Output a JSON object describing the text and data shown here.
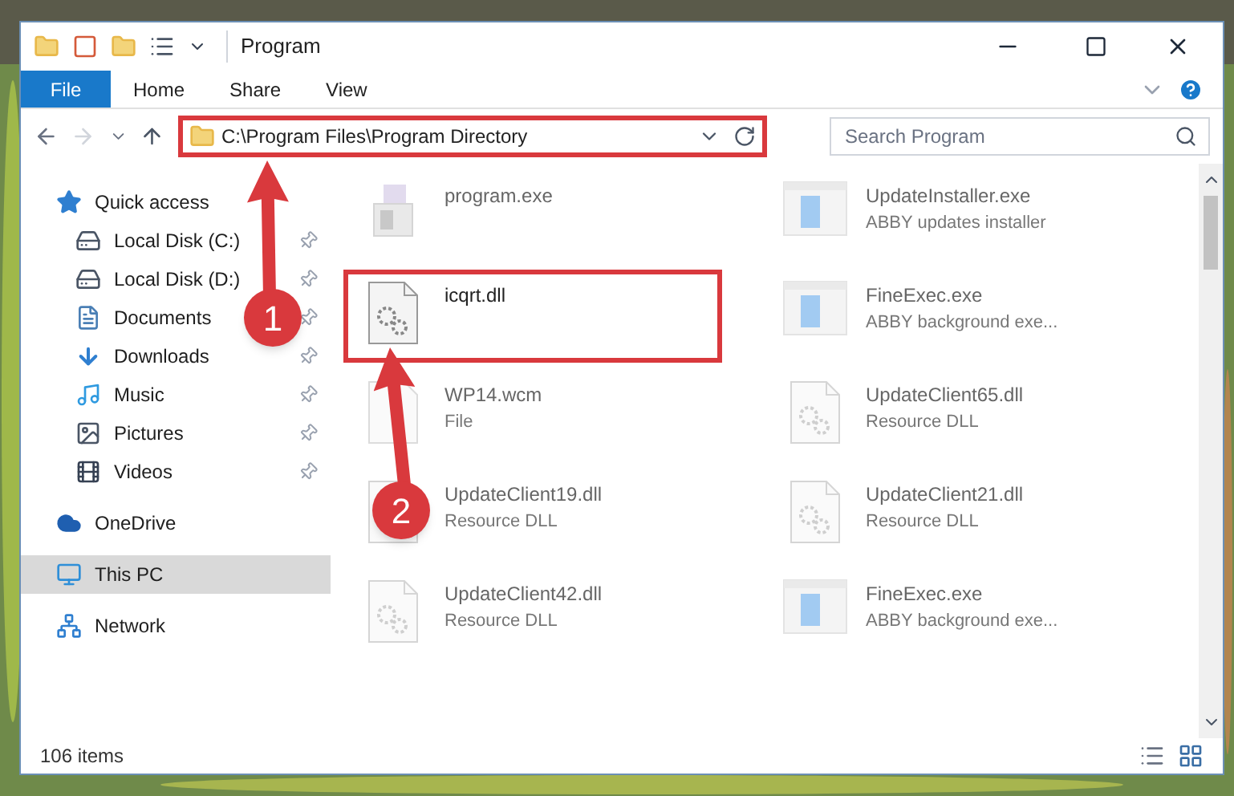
{
  "window": {
    "title": "Program"
  },
  "ribbon": {
    "tabs": [
      {
        "label": "File",
        "kind": "file"
      },
      {
        "label": "Home",
        "kind": "tab"
      },
      {
        "label": "Share",
        "kind": "tab"
      },
      {
        "label": "View",
        "kind": "tab"
      }
    ]
  },
  "address": {
    "path": "C:\\Program Files\\Program Directory",
    "highlighted": true
  },
  "search": {
    "placeholder": "Search Program"
  },
  "sidebar": {
    "items": [
      {
        "label": "Quick access",
        "kind": "star",
        "selected": false,
        "children": [
          {
            "label": "Local Disk (C:)",
            "kind": "drive",
            "pinned": true,
            "selected": false
          },
          {
            "label": "Local Disk (D:)",
            "kind": "drive",
            "pinned": true,
            "selected": false
          },
          {
            "label": "Documents",
            "kind": "documents",
            "pinned": true,
            "selected": false
          },
          {
            "label": "Downloads",
            "kind": "downloads",
            "pinned": true,
            "selected": false
          },
          {
            "label": "Music",
            "kind": "music",
            "pinned": true,
            "selected": false
          },
          {
            "label": "Pictures",
            "kind": "pictures",
            "pinned": true,
            "selected": false
          },
          {
            "label": "Videos",
            "kind": "videos",
            "pinned": true,
            "selected": false
          }
        ]
      },
      {
        "label": "OneDrive",
        "kind": "cloud",
        "selected": false
      },
      {
        "label": "This PC",
        "kind": "pc",
        "selected": true
      },
      {
        "label": "Network",
        "kind": "network",
        "selected": false
      }
    ]
  },
  "files": [
    {
      "name": "program.exe",
      "kind": "installer",
      "faded": true,
      "highlighted": false
    },
    {
      "name": "UpdateInstaller.exe",
      "description": "ABBY updates installer",
      "kind": "app",
      "faded": true,
      "highlighted": false
    },
    {
      "name": "icqrt.dll",
      "kind": "dll",
      "faded": false,
      "highlighted": true
    },
    {
      "name": "FineExec.exe",
      "description": "ABBY background exe...",
      "kind": "app",
      "faded": true,
      "highlighted": false
    },
    {
      "name": "WP14.wcm",
      "description": "File",
      "kind": "file",
      "faded": true,
      "highlighted": false
    },
    {
      "name": "UpdateClient65.dll",
      "description": "Resource DLL",
      "kind": "dll",
      "faded": true,
      "highlighted": false
    },
    {
      "name": "UpdateClient19.dll",
      "description": "Resource DLL",
      "kind": "dll",
      "faded": true,
      "highlighted": false
    },
    {
      "name": "UpdateClient21.dll",
      "description": "Resource DLL",
      "kind": "dll",
      "faded": true,
      "highlighted": false
    },
    {
      "name": "UpdateClient42.dll",
      "description": "Resource DLL",
      "kind": "dll",
      "faded": true,
      "highlighted": false
    },
    {
      "name": "FineExec.exe",
      "description": "ABBY background exe...",
      "kind": "app",
      "faded": true,
      "highlighted": false
    }
  ],
  "callouts": [
    {
      "number": "1"
    },
    {
      "number": "2"
    }
  ],
  "status_bar": {
    "count": "106 items"
  }
}
